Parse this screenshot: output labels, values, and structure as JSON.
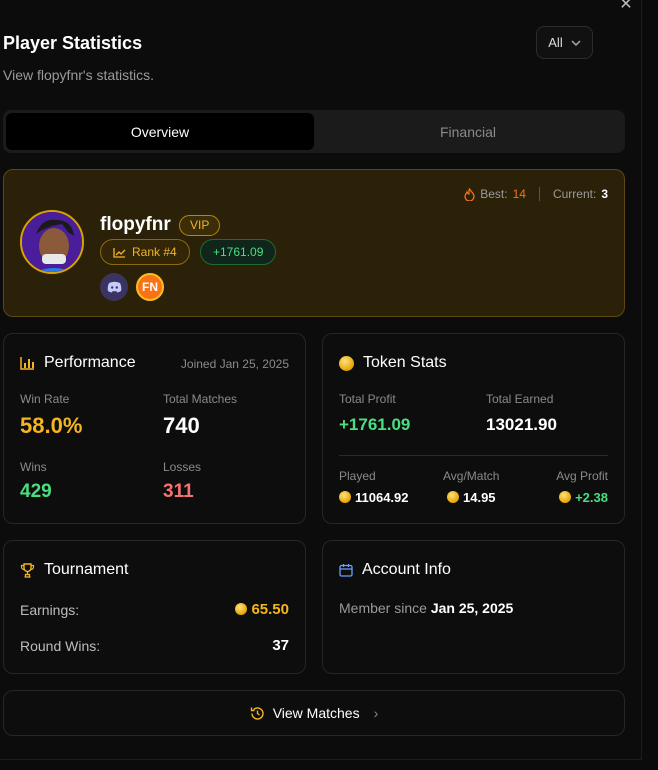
{
  "header": {
    "title": "Player Statistics",
    "subtitle": "View flopyfnr's statistics.",
    "filter_value": "All"
  },
  "tabs": [
    {
      "label": "Overview",
      "active": true
    },
    {
      "label": "Financial",
      "active": false
    }
  ],
  "profile": {
    "username": "flopyfnr",
    "vip_label": "VIP",
    "rank_label": "Rank #4",
    "profit_badge": "+1761.09",
    "best_label": "Best:",
    "best_value": "14",
    "current_label": "Current:",
    "current_value": "3",
    "fn_label": "FN",
    "icons": [
      "flame-icon",
      "trend-icon",
      "discord-icon"
    ]
  },
  "performance": {
    "title": "Performance",
    "joined": "Joined Jan 25, 2025",
    "win_rate_label": "Win Rate",
    "win_rate": "58.0%",
    "total_matches_label": "Total Matches",
    "total_matches": "740",
    "wins_label": "Wins",
    "wins": "429",
    "losses_label": "Losses",
    "losses": "311"
  },
  "token_stats": {
    "title": "Token Stats",
    "total_profit_label": "Total Profit",
    "total_profit": "+1761.09",
    "total_earned_label": "Total Earned",
    "total_earned": "13021.90",
    "played_label": "Played",
    "played": "11064.92",
    "avg_match_label": "Avg/Match",
    "avg_match": "14.95",
    "avg_profit_label": "Avg Profit",
    "avg_profit": "+2.38"
  },
  "tournament": {
    "title": "Tournament",
    "earnings_label": "Earnings:",
    "earnings": "65.50",
    "round_wins_label": "Round Wins:",
    "round_wins": "37"
  },
  "account": {
    "title": "Account Info",
    "member_label": "Member since",
    "member_since": "Jan 25, 2025"
  },
  "footer": {
    "view_matches": "View Matches"
  },
  "colors": {
    "gold": "#f5b520",
    "green": "#4ade80",
    "red": "#f87171"
  }
}
